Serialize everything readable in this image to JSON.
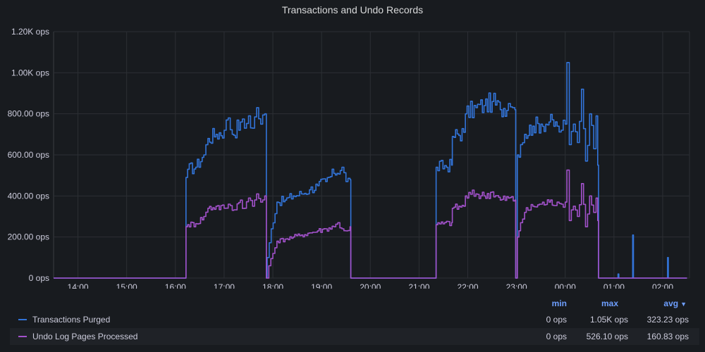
{
  "panel": {
    "title": "Transactions and Undo Records"
  },
  "chart_data": {
    "type": "line",
    "title": "Transactions and Undo Records",
    "xlabel": "",
    "ylabel": "",
    "ylim": [
      0,
      1200
    ],
    "y_ticks": [
      "0 ops",
      "200.00 ops",
      "400.00 ops",
      "600.00 ops",
      "800.00 ops",
      "1.00K ops",
      "1.20K ops"
    ],
    "y_tick_values": [
      0,
      200,
      400,
      600,
      800,
      1000,
      1200
    ],
    "xlim": [
      13.5,
      2.55
    ],
    "x_ticks": [
      "14:00",
      "15:00",
      "16:00",
      "17:00",
      "18:00",
      "19:00",
      "20:00",
      "21:00",
      "22:00",
      "23:00",
      "00:00",
      "01:00",
      "02:00"
    ],
    "grid": true,
    "legend_placement": "bottom",
    "series": [
      {
        "name": "Transactions Purged",
        "color": "#3274d9",
        "points": [
          [
            "13:30",
            0
          ],
          [
            "14:30",
            0
          ],
          [
            "15:30",
            0
          ],
          [
            "16:12",
            0
          ],
          [
            "16:13",
            490
          ],
          [
            "16:15",
            530
          ],
          [
            "16:25",
            540
          ],
          [
            "16:35",
            600
          ],
          [
            "16:40",
            680
          ],
          [
            "16:50",
            700
          ],
          [
            "17:00",
            720
          ],
          [
            "17:05",
            780
          ],
          [
            "17:10",
            700
          ],
          [
            "17:20",
            760
          ],
          [
            "17:25",
            730
          ],
          [
            "17:30",
            790
          ],
          [
            "17:35",
            730
          ],
          [
            "17:40",
            830
          ],
          [
            "17:45",
            750
          ],
          [
            "17:50",
            800
          ],
          [
            "17:52",
            0
          ],
          [
            "17:53",
            100
          ],
          [
            "17:58",
            240
          ],
          [
            "18:05",
            370
          ],
          [
            "18:15",
            380
          ],
          [
            "18:25",
            400
          ],
          [
            "18:35",
            410
          ],
          [
            "18:45",
            430
          ],
          [
            "18:55",
            450
          ],
          [
            "19:05",
            470
          ],
          [
            "19:15",
            510
          ],
          [
            "19:25",
            540
          ],
          [
            "19:30",
            470
          ],
          [
            "19:35",
            480
          ],
          [
            "19:36",
            0
          ],
          [
            "20:30",
            0
          ],
          [
            "21:20",
            0
          ],
          [
            "21:21",
            540
          ],
          [
            "21:40",
            550
          ],
          [
            "21:41",
            690
          ],
          [
            "21:55",
            710
          ],
          [
            "21:57",
            800
          ],
          [
            "22:10",
            830
          ],
          [
            "22:20",
            840
          ],
          [
            "22:30",
            860
          ],
          [
            "22:40",
            820
          ],
          [
            "22:50",
            850
          ],
          [
            "22:55",
            830
          ],
          [
            "22:58",
            820
          ],
          [
            "22:59",
            0
          ],
          [
            "23:00",
            0
          ],
          [
            "23:01",
            600
          ],
          [
            "23:05",
            650
          ],
          [
            "23:10",
            700
          ],
          [
            "23:20",
            740
          ],
          [
            "23:30",
            750
          ],
          [
            "23:40",
            760
          ],
          [
            "23:50",
            740
          ],
          [
            "23:55",
            720
          ],
          [
            "00:00",
            750
          ],
          [
            "00:02",
            1050
          ],
          [
            "00:05",
            650
          ],
          [
            "00:10",
            750
          ],
          [
            "00:15",
            660
          ],
          [
            "00:20",
            920
          ],
          [
            "00:25",
            570
          ],
          [
            "00:30",
            800
          ],
          [
            "00:35",
            630
          ],
          [
            "00:38",
            790
          ],
          [
            "00:40",
            550
          ],
          [
            "00:41",
            0
          ],
          [
            "01:00",
            0
          ],
          [
            "01:05",
            20
          ],
          [
            "01:06",
            0
          ],
          [
            "01:22",
            0
          ],
          [
            "01:23",
            210
          ],
          [
            "01:24",
            0
          ],
          [
            "02:05",
            0
          ],
          [
            "02:06",
            100
          ],
          [
            "02:07",
            0
          ],
          [
            "02:30",
            0
          ]
        ]
      },
      {
        "name": "Undo Log Pages Processed",
        "color": "#a352cc",
        "points": [
          [
            "13:30",
            0
          ],
          [
            "14:30",
            0
          ],
          [
            "15:30",
            0
          ],
          [
            "16:12",
            0
          ],
          [
            "16:13",
            250
          ],
          [
            "16:15",
            260
          ],
          [
            "16:25",
            265
          ],
          [
            "16:35",
            300
          ],
          [
            "16:40",
            340
          ],
          [
            "16:50",
            350
          ],
          [
            "17:00",
            340
          ],
          [
            "17:05",
            360
          ],
          [
            "17:10",
            330
          ],
          [
            "17:20",
            380
          ],
          [
            "17:25",
            340
          ],
          [
            "17:30",
            390
          ],
          [
            "17:35",
            350
          ],
          [
            "17:40",
            410
          ],
          [
            "17:45",
            370
          ],
          [
            "17:50",
            400
          ],
          [
            "17:52",
            0
          ],
          [
            "17:55",
            60
          ],
          [
            "18:00",
            120
          ],
          [
            "18:05",
            180
          ],
          [
            "18:15",
            190
          ],
          [
            "18:25",
            200
          ],
          [
            "18:35",
            210
          ],
          [
            "18:45",
            220
          ],
          [
            "18:55",
            230
          ],
          [
            "19:05",
            240
          ],
          [
            "19:15",
            250
          ],
          [
            "19:20",
            270
          ],
          [
            "19:25",
            240
          ],
          [
            "19:30",
            230
          ],
          [
            "19:35",
            250
          ],
          [
            "19:36",
            0
          ],
          [
            "20:30",
            0
          ],
          [
            "21:20",
            0
          ],
          [
            "21:21",
            260
          ],
          [
            "21:40",
            270
          ],
          [
            "21:41",
            340
          ],
          [
            "21:55",
            350
          ],
          [
            "21:57",
            400
          ],
          [
            "22:10",
            410
          ],
          [
            "22:20",
            400
          ],
          [
            "22:30",
            420
          ],
          [
            "22:40",
            380
          ],
          [
            "22:50",
            390
          ],
          [
            "22:58",
            380
          ],
          [
            "22:59",
            0
          ],
          [
            "23:00",
            0
          ],
          [
            "23:01",
            200
          ],
          [
            "23:05",
            270
          ],
          [
            "23:10",
            320
          ],
          [
            "23:20",
            350
          ],
          [
            "23:30",
            360
          ],
          [
            "23:40",
            370
          ],
          [
            "23:50",
            370
          ],
          [
            "23:55",
            360
          ],
          [
            "00:00",
            370
          ],
          [
            "00:02",
            526
          ],
          [
            "00:05",
            280
          ],
          [
            "00:10",
            350
          ],
          [
            "00:15",
            300
          ],
          [
            "00:20",
            460
          ],
          [
            "00:25",
            250
          ],
          [
            "00:30",
            400
          ],
          [
            "00:35",
            320
          ],
          [
            "00:38",
            390
          ],
          [
            "00:40",
            280
          ],
          [
            "00:41",
            0
          ],
          [
            "01:00",
            0
          ],
          [
            "02:30",
            0
          ]
        ]
      }
    ]
  },
  "legend": {
    "headers": {
      "min": "min",
      "max": "max",
      "avg": "avg"
    },
    "sort_icon": "chevron-down-icon",
    "rows": [
      {
        "name": "Transactions Purged",
        "color": "#3274d9",
        "min": "0 ops",
        "max": "1.05K ops",
        "avg": "323.23 ops"
      },
      {
        "name": "Undo Log Pages Processed",
        "color": "#a352cc",
        "min": "0 ops",
        "max": "526.10 ops",
        "avg": "160.83 ops"
      }
    ]
  }
}
